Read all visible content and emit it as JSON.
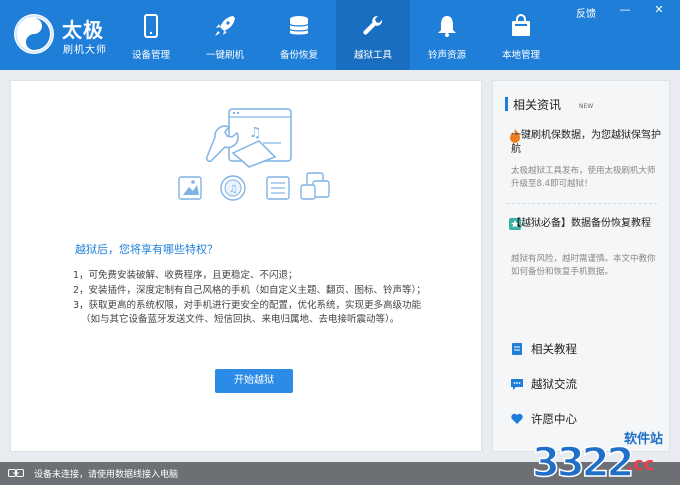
{
  "app": {
    "title": "太极",
    "subtitle": "刷机大师"
  },
  "nav": {
    "items": [
      {
        "label": "设备管理",
        "icon": "phone-icon"
      },
      {
        "label": "一键刷机",
        "icon": "rocket-icon"
      },
      {
        "label": "备份恢复",
        "icon": "database-icon"
      },
      {
        "label": "越狱工具",
        "icon": "wrench-icon",
        "active": true
      },
      {
        "label": "铃声资源",
        "icon": "bell-icon"
      },
      {
        "label": "本地管理",
        "icon": "bag-icon"
      }
    ]
  },
  "window": {
    "feedback": "反馈",
    "minimize": "—",
    "close": "✕"
  },
  "main": {
    "section_title": "越狱后，您将享有哪些特权？",
    "privileges": [
      "1，可免费安装破解、收费程序，且更稳定、不闪退；",
      "2，安装插件，深度定制有自己风格的手机（如自定义主题、翻页、图标、铃声等）；",
      "3，获取更高的系统权限，对手机进行更安全的配置，优化系统，实现更多高级功能",
      "（如与其它设备蓝牙发送文件、短信回执、来电归属地、去电接听震动等）。"
    ],
    "start_button": "开始越狱"
  },
  "side": {
    "heading": "相关资讯",
    "heading_badge": "NEW",
    "news": [
      {
        "icon": "flame-icon",
        "title": "一键刷机保数据，为您越狱保驾护航",
        "desc": "太极越狱工具发布，使用太极刷机大师升级至8.4即可越狱！"
      },
      {
        "icon": "star-icon",
        "title": "【越狱必备】数据备份恢复教程",
        "desc": "越狱有风险，越时需谨慎。本文中教你如何备份和恢复手机数据。"
      }
    ],
    "links": [
      {
        "label": "相关教程",
        "icon": "book-icon"
      },
      {
        "label": "越狱交流",
        "icon": "chat-icon"
      },
      {
        "label": "许愿中心",
        "icon": "heart-icon"
      }
    ]
  },
  "status": {
    "text": "设备未连接，请使用数据线接入电脑"
  },
  "watermark": {
    "brand": "3322",
    "site": "软件站",
    "domain": ".cc"
  },
  "colors": {
    "brand": "#1f7fd8",
    "active_nav": "#1a6ec2",
    "button": "#2c8be6"
  }
}
